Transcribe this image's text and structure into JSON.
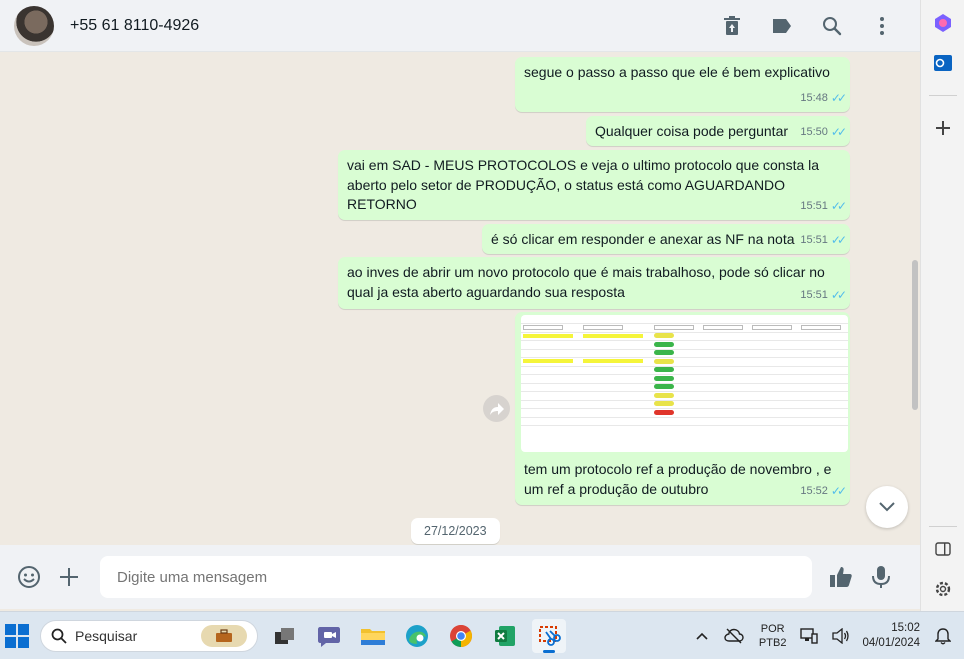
{
  "header": {
    "contact": "+55 61 8110-4926"
  },
  "messages": [
    {
      "text": "segue o passo a passo que ele é bem explicativo",
      "time": "15:48"
    },
    {
      "text": "Qualquer coisa pode perguntar",
      "time": "15:50"
    },
    {
      "text": "vai em SAD - MEUS PROTOCOLOS e veja o ultimo protocolo que consta la aberto pelo setor de PRODUÇÃO, o status está como AGUARDANDO RETORNO",
      "time": "15:51"
    },
    {
      "text": "é só clicar em responder e anexar as NF na nota",
      "time": "15:51"
    },
    {
      "text": "ao inves de abrir um novo protocolo que é mais trabalhoso, pode só clicar no qual ja esta aberto aguardando sua resposta",
      "time": "15:51"
    },
    {
      "text": "tem um protocolo ref a produção de novembro , e um ref a produção de outubro",
      "time": "15:52"
    }
  ],
  "date_chip": "27/12/2023",
  "composer": {
    "placeholder": "Digite uma mensagem"
  },
  "taskbar": {
    "search_label": "Pesquisar",
    "lang_line1": "POR",
    "lang_line2": "PTB2",
    "time": "15:02",
    "date": "04/01/2024"
  },
  "colors": {
    "bubble": "#d9fdd3",
    "chat_bg": "#efeae2",
    "read_ticks": "#53bdeb",
    "header_bg": "#f0f2f5"
  }
}
